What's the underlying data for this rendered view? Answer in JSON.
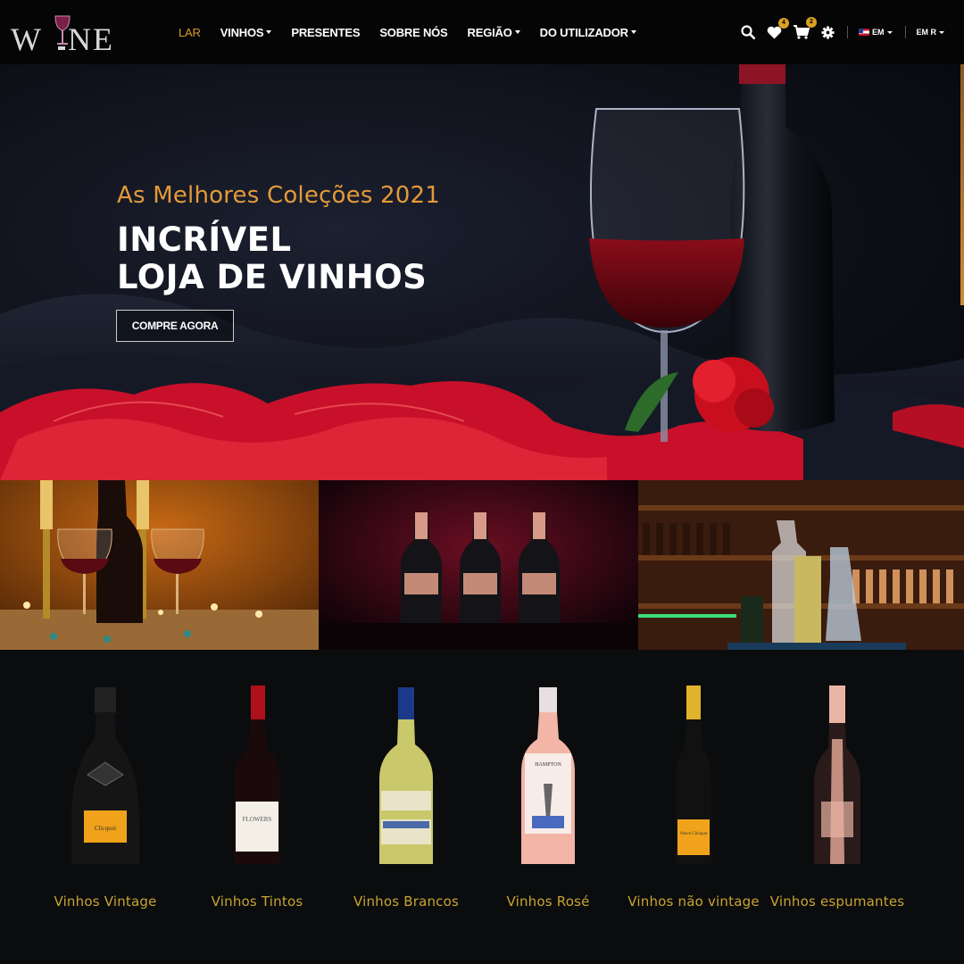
{
  "brand": {
    "logo_text": "WINE",
    "accent": "#d79a2a"
  },
  "nav": {
    "items": [
      {
        "label": "LAR",
        "active": true,
        "dropdown": false
      },
      {
        "label": "VINHOS",
        "active": false,
        "dropdown": true
      },
      {
        "label": "PRESENTES",
        "active": false,
        "dropdown": false
      },
      {
        "label": "SOBRE NÓS",
        "active": false,
        "dropdown": false
      },
      {
        "label": "REGIÃO",
        "active": false,
        "dropdown": true
      },
      {
        "label": "DO UTILIZADOR",
        "active": false,
        "dropdown": true
      }
    ],
    "wishlist_count": "4",
    "cart_count": "2",
    "language": "EM",
    "currency": "EM R"
  },
  "hero": {
    "subtitle": "As Melhores Coleções 2021",
    "title_line1": "INCRÍVEL",
    "title_line2": "LOJA DE VINHOS",
    "button": "COMPRE AGORA"
  },
  "categories": [
    {
      "label": "Vinhos Vintage",
      "icon": "vintage-bottle-icon"
    },
    {
      "label": "Vinhos Tintos",
      "icon": "red-wine-bottle-icon"
    },
    {
      "label": "Vinhos Brancos",
      "icon": "white-wine-bottle-icon"
    },
    {
      "label": "Vinhos Rosé",
      "icon": "rose-wine-bottle-icon"
    },
    {
      "label": "Vinhos não vintage",
      "icon": "champagne-bottle-icon"
    },
    {
      "label": "Vinhos espumantes",
      "icon": "sparkling-bottle-icon"
    }
  ]
}
